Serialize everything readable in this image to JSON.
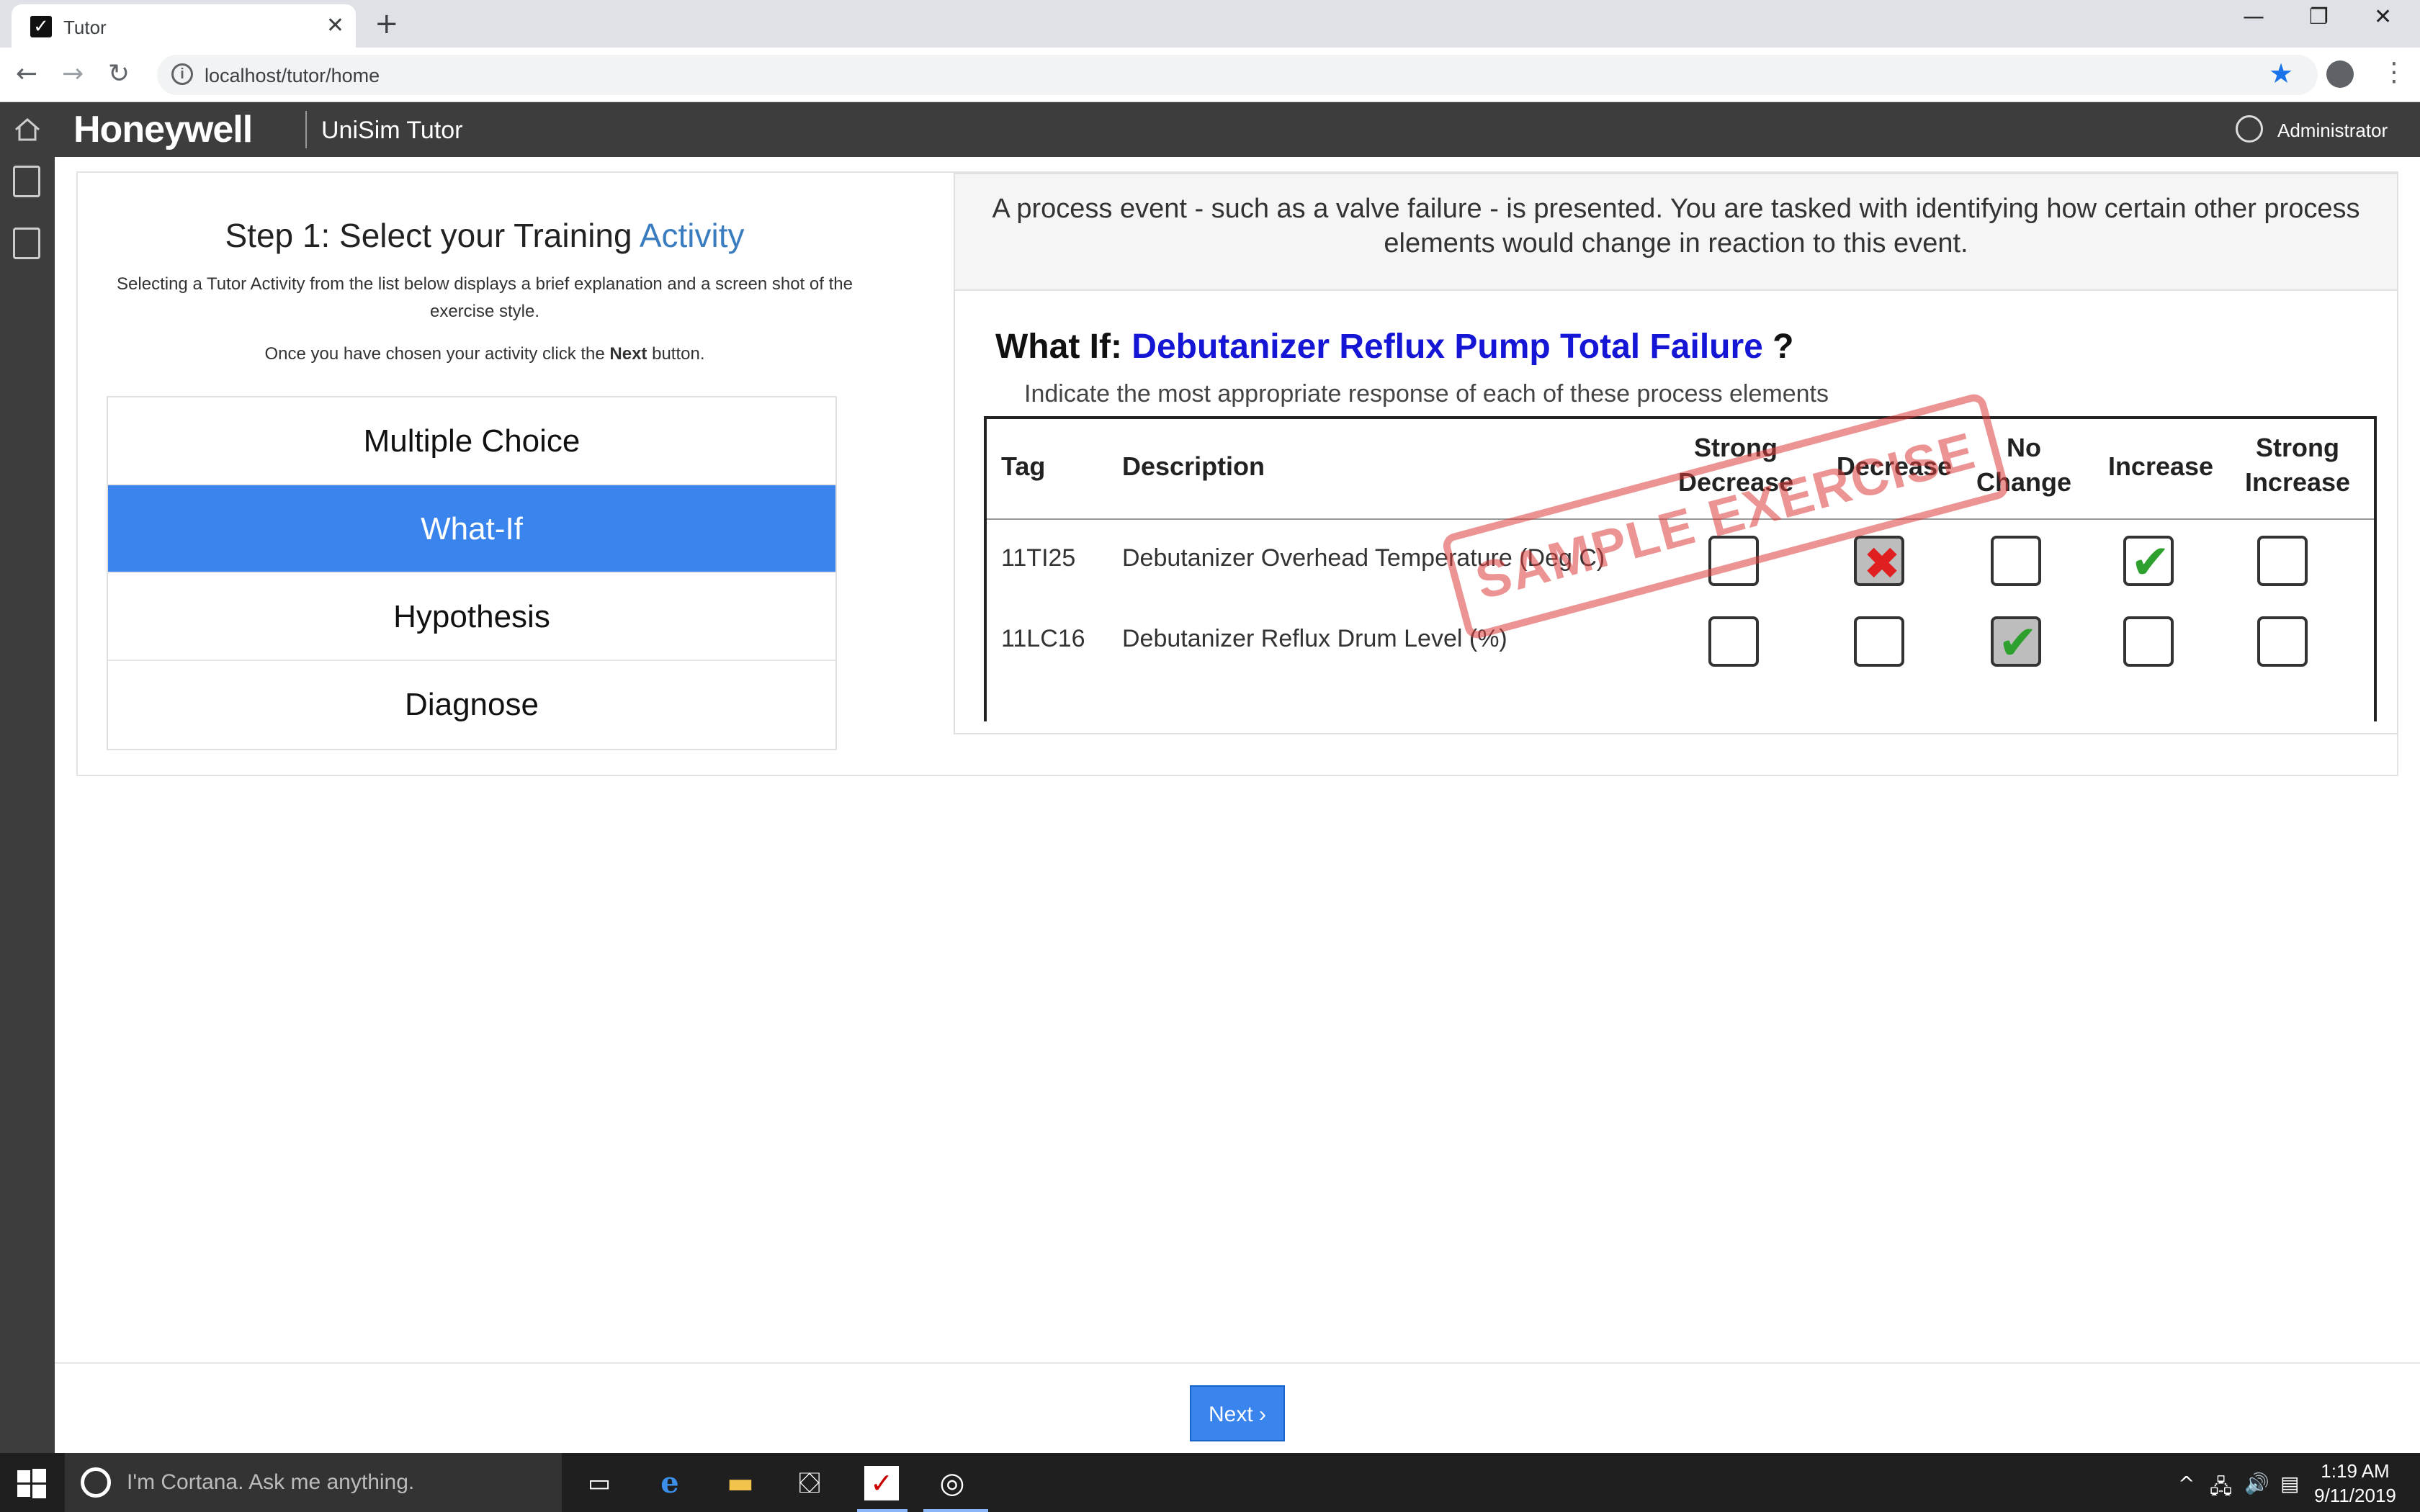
{
  "browser": {
    "tab_title": "Tutor",
    "url": "localhost/tutor/home",
    "tab_close": "✕",
    "new_tab": "+"
  },
  "app": {
    "brand": "Honeywell",
    "title": "UniSim Tutor",
    "user": "Administrator"
  },
  "step": {
    "title_prefix": "Step 1: Select your Training ",
    "title_accent": "Activity",
    "description": "Selecting a Tutor Activity from the list below displays a brief explanation and a screen shot of the exercise style.",
    "hint_prefix": "Once you have chosen your activity click the ",
    "hint_bold": "Next",
    "hint_suffix": " button."
  },
  "activities": [
    {
      "label": "Multiple Choice",
      "selected": false
    },
    {
      "label": "What-If",
      "selected": true
    },
    {
      "label": "Hypothesis",
      "selected": false
    },
    {
      "label": "Diagnose",
      "selected": false
    }
  ],
  "preview": {
    "description": "A process event - such as a valve failure - is presented. You are tasked with identifying how certain other process elements would change in reaction to this event.",
    "whatif_prefix": "What If: ",
    "whatif_event": "Debutanizer Reflux Pump Total Failure",
    "whatif_suffix": " ?",
    "instruction": "Indicate the most appropriate response of each of these process elements",
    "stamp": "SAMPLE EXERCISE",
    "columns": {
      "tag": "Tag",
      "description": "Description",
      "strong_decrease_1": "Strong",
      "strong_decrease_2": "Decrease",
      "decrease": "Decrease",
      "no_change_1": "No",
      "no_change_2": "Change",
      "increase": "Increase",
      "strong_increase_1": "Strong",
      "strong_increase_2": "Increase"
    },
    "rows": [
      {
        "tag": "11TI25",
        "description": "Debutanizer Overhead Temperature (Deg C)"
      },
      {
        "tag": "11LC16",
        "description": "Debutanizer Reflux Drum Level (%)"
      }
    ]
  },
  "footer": {
    "next_label": "Next ›"
  },
  "taskbar": {
    "cortana_placeholder": "I'm Cortana. Ask me anything.",
    "time": "1:19 AM",
    "date": "9/11/2019"
  }
}
